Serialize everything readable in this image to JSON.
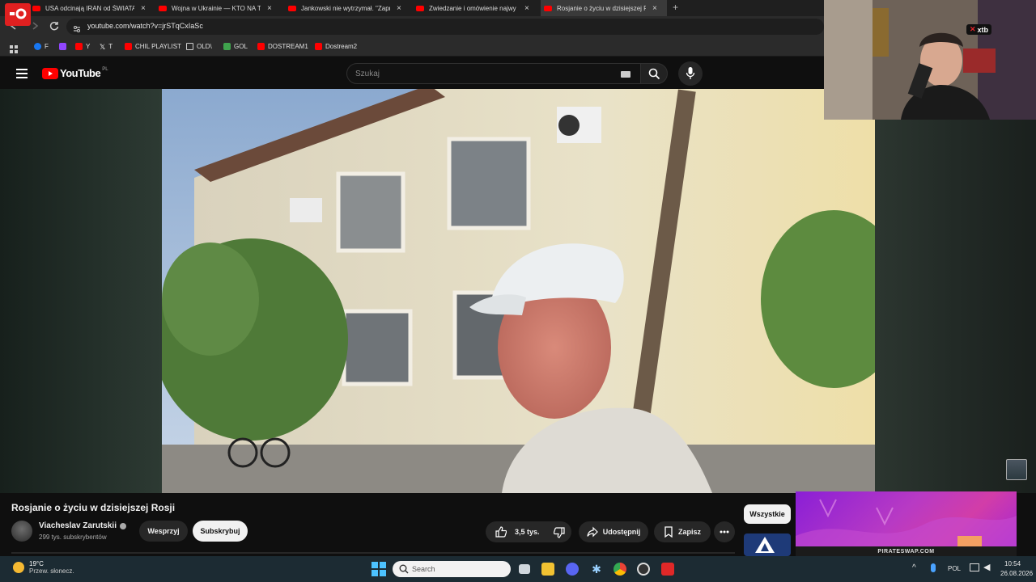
{
  "tabs": [
    {
      "title": "USA odcinają IRAN od ŚWIATA",
      "active": false
    },
    {
      "title": "Wojna w Ukrainie — KTO NA T",
      "active": false
    },
    {
      "title": "Jankowski nie wytrzymał. \"Zapr",
      "active": false
    },
    {
      "title": "Zwiedzanie i omówienie najwy",
      "active": false
    },
    {
      "title": "Rosjanie o życiu w dzisiejszej R",
      "active": true
    }
  ],
  "close_glyph": "×",
  "new_tab_glyph": "+",
  "url": "youtube.com/watch?v=jrSTqCxIaSc",
  "bookmarks": [
    "F",
    "Y",
    "T",
    "CHIL PLAYLIST",
    "OLD\\",
    "GOL",
    "DOSTREAM1",
    "Dostream2"
  ],
  "youtube": {
    "logo_text": "YouTube",
    "region": "PL",
    "search_placeholder": "Szukaj"
  },
  "video": {
    "title": "Rosjanie o życiu w dzisiejszej Rosji",
    "channel_name": "Viacheslav Zarutskii",
    "subscribers": "299 tys. subskrybentów",
    "support_label": "Wesprzyj",
    "subscribe_label": "Subskrybuj",
    "likes": "3,5 tys.",
    "share_label": "Udostępnij",
    "save_label": "Zapisz"
  },
  "filter_chip": "Wszystkie",
  "webcam_badge": "xtb",
  "ad_text": "PIRATESWAP.COM",
  "taskbar": {
    "weather_temp": "19°C",
    "weather_desc": "Przew. słonecz.",
    "search_placeholder": "Search",
    "language": "POL",
    "time": "10:54",
    "date": "26.08.2026"
  },
  "colors": {
    "youtube_red": "#ff0000",
    "background": "#0f0f0f",
    "taskbar": "#1c2b33"
  }
}
